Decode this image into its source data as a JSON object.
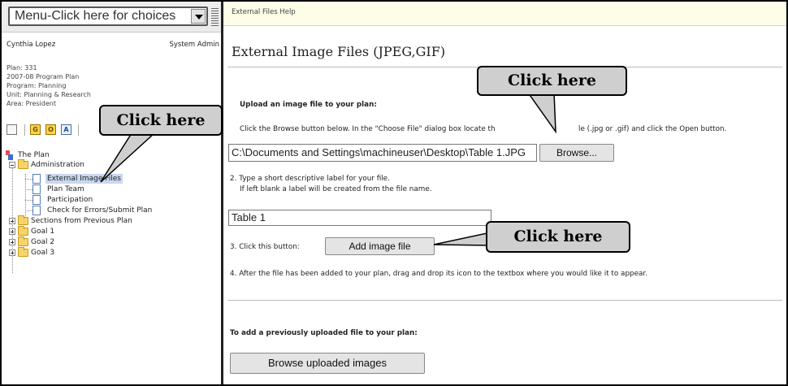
{
  "menu": {
    "select_label": "Menu-Click here for choices"
  },
  "user": {
    "name": "Cynthia Lopez",
    "role": "System Admin"
  },
  "plan_info": {
    "plan": "Plan: 331",
    "year": "2007-08 Program Plan",
    "program": "Program: Planning",
    "unit": "Unit: Planning & Research",
    "area": "Area: President"
  },
  "toolbar": {
    "btn_g": "G",
    "btn_o": "O",
    "btn_a": "A"
  },
  "tree": {
    "root": "The Plan",
    "administration": "Administration",
    "items": [
      "External Image Files",
      "Plan Team",
      "Participation",
      "Check for Errors/Submit Plan"
    ],
    "sections": "Sections from Previous Plan",
    "goals": [
      "Goal 1",
      "Goal 2",
      "Goal 3"
    ]
  },
  "help_bar": {
    "text": "External Files Help"
  },
  "page": {
    "title": "External Image Files (JPEG,GIF)",
    "upload_heading": "Upload an image file to your plan:",
    "step1_a": "Click the Browse button below. In the \"Choose File\" dialog box locate th",
    "step1_b": "le (.jpg or .gif) and click the Open button.",
    "file_path_value": "C:\\Documents and Settings\\machineuser\\Desktop\\Table 1.JPG",
    "browse_label": "Browse...",
    "step2_line1": "2. Type a short descriptive label for your file.",
    "step2_line2": "If left blank a label will be created from the file name.",
    "label_value": "Table 1",
    "step3": "3. Click this button:",
    "add_button": "Add image file",
    "step4": "4. After the file has been added to your plan, drag and drop its icon to the textbox where you would like it to appear.",
    "previous_heading": "To add a previously uploaded file to your plan:",
    "browse_uploaded_button": "Browse uploaded images"
  },
  "callouts": [
    "Click here",
    "Click here",
    "Click here"
  ]
}
